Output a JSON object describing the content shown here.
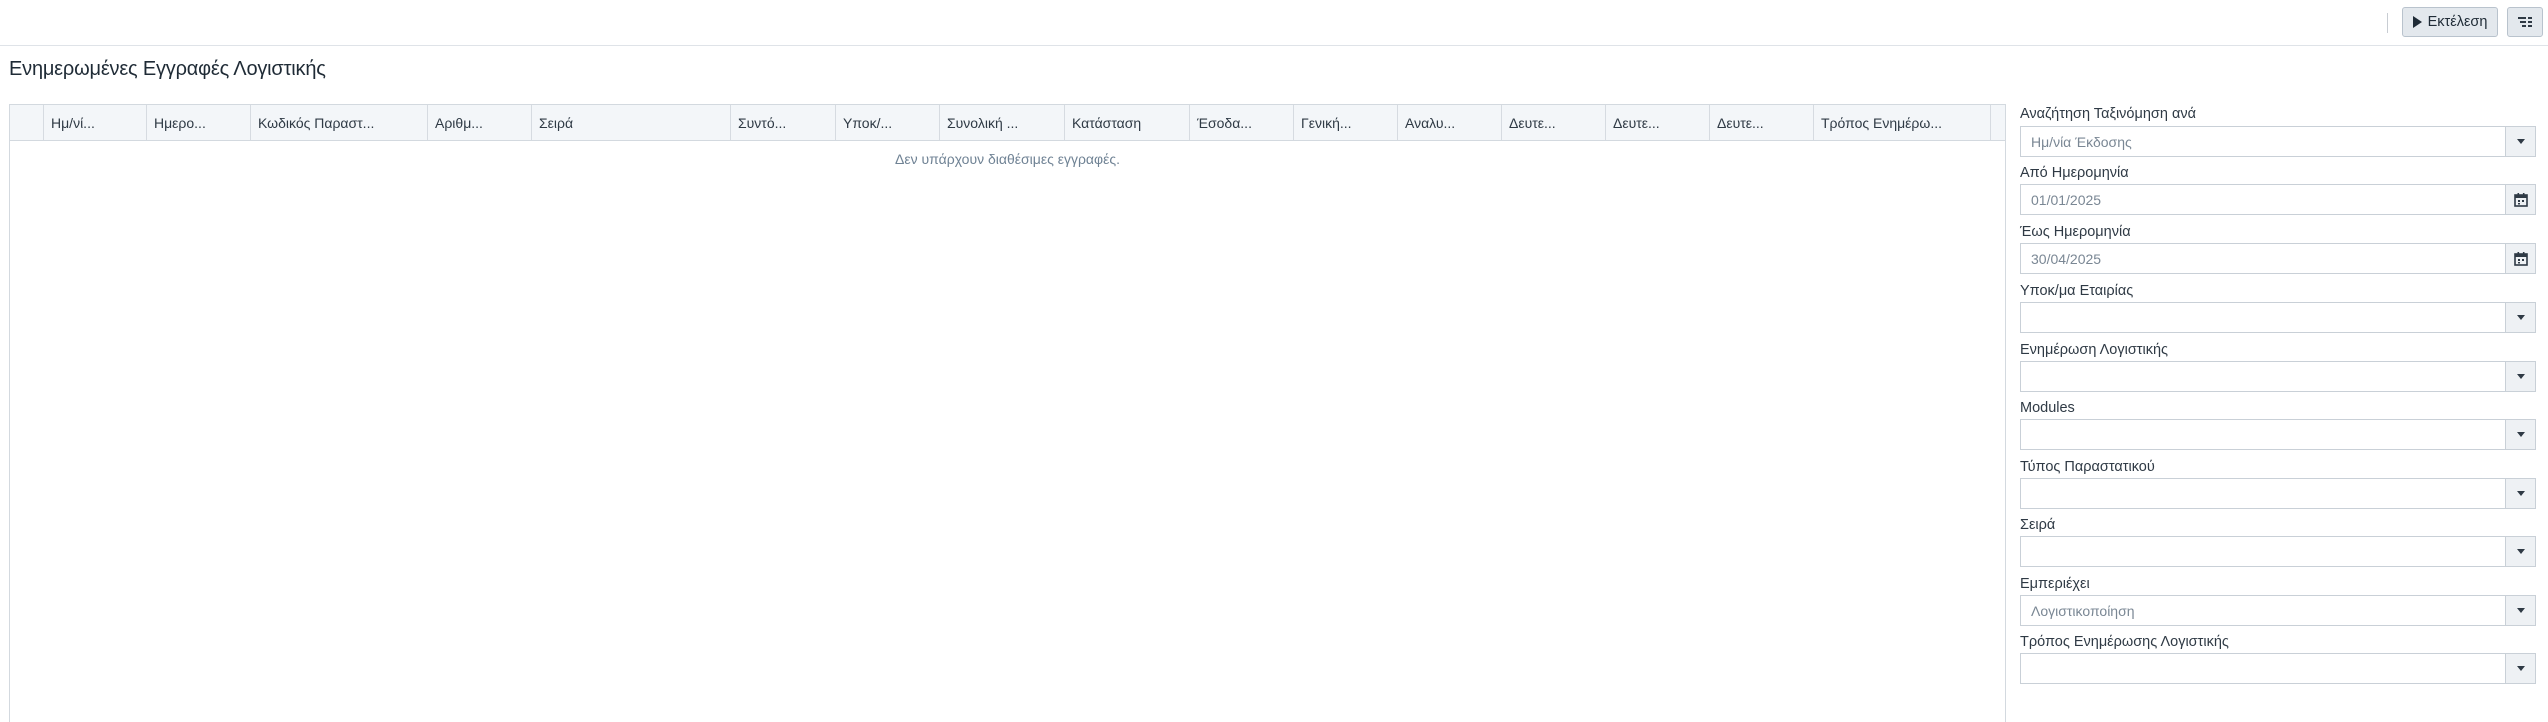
{
  "toolbar": {
    "run_label": "Εκτέλεση"
  },
  "page": {
    "title": "Ενημερωμένες Εγγραφές Λογιστικής"
  },
  "grid": {
    "columns": [
      "Ημ/νί...",
      "Ημερο...",
      "Κωδικός Παραστ...",
      "Αριθμ...",
      "Σειρά",
      "Συντό...",
      "Υποκ/...",
      "Συνολική ...",
      "Κατάσταση",
      "Έσοδα...",
      "Γενική...",
      "Αναλυ...",
      "Δευτε...",
      "Δευτε...",
      "Δευτε...",
      "Τρόπος Ενημέρω..."
    ],
    "empty_message": "Δεν υπάρχουν διαθέσιμες εγγραφές."
  },
  "filters": {
    "sort_by": {
      "label": "Αναζήτηση Ταξινόμηση ανά",
      "value": "Ημ/νία Έκδοσης"
    },
    "from_date": {
      "label": "Από Ημερομηνία",
      "value": "01/01/2025"
    },
    "to_date": {
      "label": "Έως Ημερομηνία",
      "value": "30/04/2025"
    },
    "company_branch": {
      "label": "Υποκ/μα Εταιρίας",
      "value": ""
    },
    "accounting_update": {
      "label": "Ενημέρωση Λογιστικής",
      "value": ""
    },
    "modules": {
      "label": "Modules",
      "value": ""
    },
    "document_type": {
      "label": "Τύπος Παραστατικού",
      "value": ""
    },
    "series": {
      "label": "Σειρά",
      "value": ""
    },
    "contains": {
      "label": "Εμπεριέχει",
      "value": "Λογιστικοποίηση"
    },
    "update_method": {
      "label": "Τρόπος Ενημέρωσης Λογιστικής",
      "value": ""
    }
  }
}
